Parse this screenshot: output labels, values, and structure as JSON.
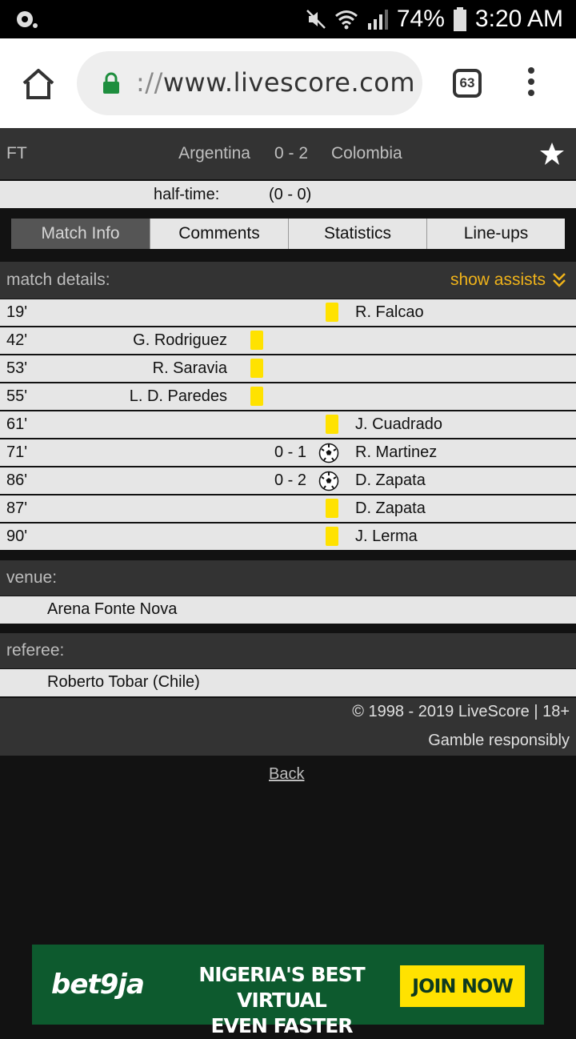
{
  "status_bar": {
    "battery": "74%",
    "time": "3:20 AM"
  },
  "browser": {
    "url_scheme": "://",
    "url_host": "www.livescore.com",
    "tab_count": "63"
  },
  "match": {
    "status": "FT",
    "home_team": "Argentina",
    "score": "0 - 2",
    "away_team": "Colombia",
    "halftime_label": "half-time:",
    "halftime_score": "(0 - 0)"
  },
  "tabs": [
    {
      "label": "Match Info",
      "active": true
    },
    {
      "label": "Comments",
      "active": false
    },
    {
      "label": "Statistics",
      "active": false
    },
    {
      "label": "Line-ups",
      "active": false
    }
  ],
  "details": {
    "title": "match details:",
    "show_assists": "show assists",
    "events": [
      {
        "minute": "19'",
        "side": "away",
        "type": "yellow-card",
        "player": "R. Falcao",
        "score": ""
      },
      {
        "minute": "42'",
        "side": "home",
        "type": "yellow-card",
        "player": "G. Rodriguez",
        "score": ""
      },
      {
        "minute": "53'",
        "side": "home",
        "type": "yellow-card",
        "player": "R. Saravia",
        "score": ""
      },
      {
        "minute": "55'",
        "side": "home",
        "type": "yellow-card",
        "player": "L. D. Paredes",
        "score": ""
      },
      {
        "minute": "61'",
        "side": "away",
        "type": "yellow-card",
        "player": "J. Cuadrado",
        "score": ""
      },
      {
        "minute": "71'",
        "side": "away",
        "type": "goal",
        "player": "R. Martinez",
        "score": "0 - 1"
      },
      {
        "minute": "86'",
        "side": "away",
        "type": "goal",
        "player": "D. Zapata",
        "score": "0 - 2"
      },
      {
        "minute": "87'",
        "side": "away",
        "type": "yellow-card",
        "player": "D. Zapata",
        "score": ""
      },
      {
        "minute": "90'",
        "side": "away",
        "type": "yellow-card",
        "player": "J. Lerma",
        "score": ""
      }
    ]
  },
  "venue": {
    "label": "venue:",
    "value": "Arena Fonte Nova"
  },
  "referee": {
    "label": "referee:",
    "value": "Roberto Tobar (Chile)"
  },
  "footer": {
    "copyright": "© 1998 - 2019 LiveScore | 18+",
    "gamble": "Gamble responsibly"
  },
  "back_label": "Back",
  "ad": {
    "logo": "bet9ja",
    "line1": "NIGERIA'S BEST VIRTUAL",
    "line2": "EVEN FASTER",
    "cta": "JOIN NOW"
  },
  "colors": {
    "accent": "#f0b31a",
    "card_yellow": "#ffe200",
    "header_bg": "#333333",
    "row_bg": "#e6e6e6"
  }
}
